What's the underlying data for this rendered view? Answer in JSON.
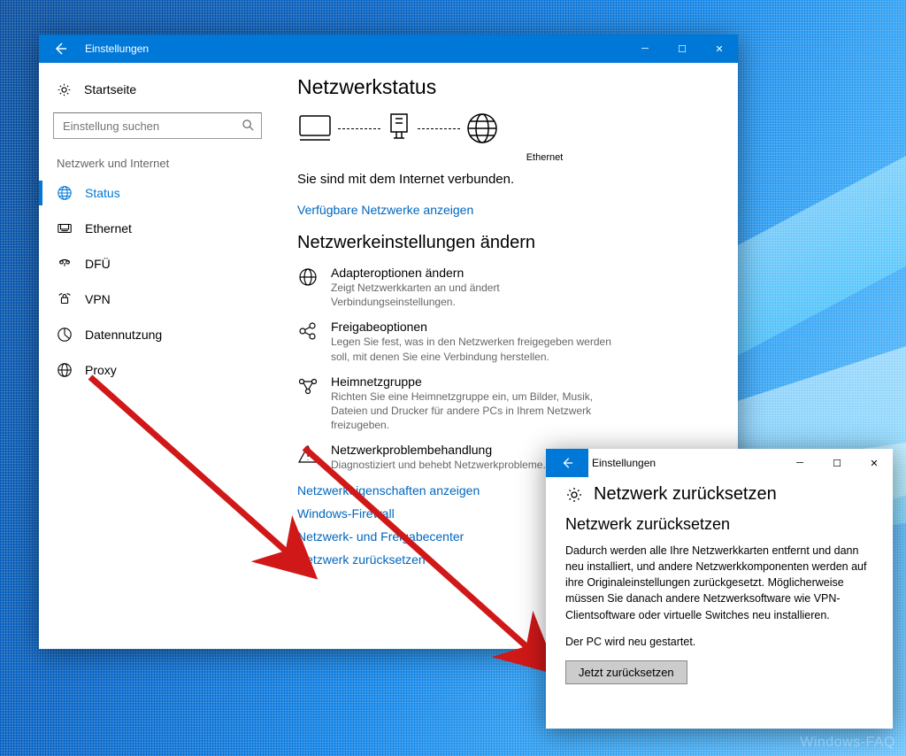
{
  "colors": {
    "accent": "#0078d7",
    "link": "#0066bf"
  },
  "main_window": {
    "title": "Einstellungen",
    "home": "Startseite",
    "search_placeholder": "Einstellung suchen",
    "section": "Netzwerk und Internet",
    "nav": [
      "Status",
      "Ethernet",
      "DFÜ",
      "VPN",
      "Datennutzung",
      "Proxy"
    ],
    "content": {
      "h1": "Netzwerkstatus",
      "diagram_label": "Ethernet",
      "connected_text": "Sie sind mit dem Internet verbunden.",
      "available_link": "Verfügbare Netzwerke anzeigen",
      "h2": "Netzwerkeinstellungen ändern",
      "options": [
        {
          "title": "Adapteroptionen ändern",
          "desc": "Zeigt Netzwerkkarten an und ändert Verbindungseinstellungen."
        },
        {
          "title": "Freigabeoptionen",
          "desc": "Legen Sie fest, was in den Netzwerken freigegeben werden soll, mit denen Sie eine Verbindung herstellen."
        },
        {
          "title": "Heimnetzgruppe",
          "desc": "Richten Sie eine Heimnetzgruppe ein, um Bilder, Musik, Dateien und Drucker für andere PCs in Ihrem Netzwerk freizugeben."
        },
        {
          "title": "Netzwerkproblembehandlung",
          "desc": "Diagnostiziert und behebt Netzwerkprobleme."
        }
      ],
      "links": [
        "Netzwerkeigenschaften anzeigen",
        "Windows-Firewall",
        "Netzwerk- und Freigabecenter",
        "Netzwerk zurücksetzen"
      ]
    }
  },
  "dialog": {
    "title": "Einstellungen",
    "heading": "Netzwerk zurücksetzen",
    "subheading": "Netzwerk zurücksetzen",
    "body": "Dadurch werden alle Ihre Netzwerkkarten entfernt und dann neu installiert, und andere Netzwerkkomponenten werden auf ihre Originaleinstellungen zurückgesetzt. Möglicherweise müssen Sie danach andere Netzwerksoftware wie VPN-Clientsoftware oder virtuelle Switches neu installieren.",
    "restart": "Der PC wird neu gestartet.",
    "button": "Jetzt zurücksetzen"
  },
  "watermark": "Windows-FAQ"
}
